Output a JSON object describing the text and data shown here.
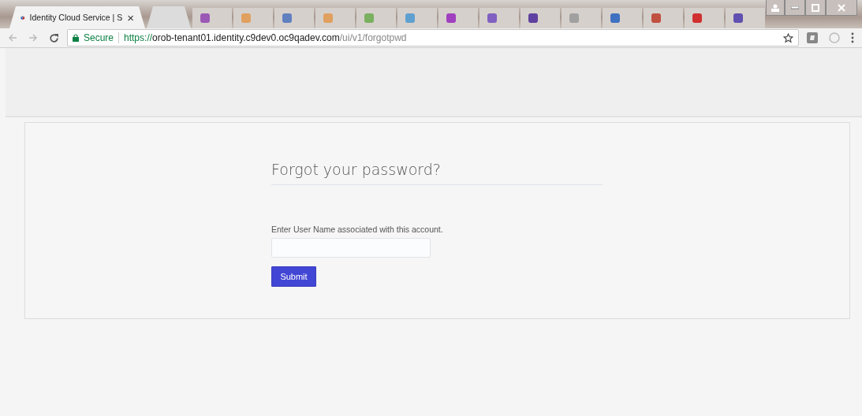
{
  "tabs": [
    {
      "title": "Identity Cloud Service | S",
      "close": "×",
      "selected": true
    },
    {
      "selected": false
    }
  ],
  "blurred_tabs": [
    {
      "color": "#9b59b6"
    },
    {
      "color": "#e0a060"
    },
    {
      "color": "#6080c0"
    },
    {
      "color": "#e0a060"
    },
    {
      "color": "#7ab060"
    },
    {
      "color": "#60a0d0"
    },
    {
      "color": "#a040c0"
    },
    {
      "color": "#8060c0"
    },
    {
      "color": "#6040a0"
    },
    {
      "color": "#a0a0a0"
    },
    {
      "color": "#4070c0"
    },
    {
      "color": "#c05040"
    },
    {
      "color": "#d03030"
    },
    {
      "color": "#6050b0"
    }
  ],
  "address_bar": {
    "security": "Secure",
    "scheme": "https://",
    "host": "orob-tenant01.identity.c9dev0.oc9qadev.com",
    "path": "/ui/v1/forgotpwd"
  },
  "form": {
    "title": "Forgot your password?",
    "label": "Enter User Name associated with this account.",
    "button": "Submit"
  }
}
